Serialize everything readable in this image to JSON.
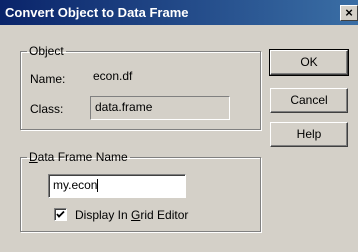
{
  "window": {
    "title": "Convert Object to Data Frame",
    "close_glyph": "✕"
  },
  "object_group": {
    "legend": "Object",
    "name_label": "Name:",
    "name_value": "econ.df",
    "class_label": "Class:",
    "class_value": "data.frame"
  },
  "buttons": {
    "ok": "OK",
    "cancel": "Cancel",
    "help": "Help"
  },
  "dataframe_group": {
    "legend_prefix": "",
    "legend_accel": "D",
    "legend_rest": "ata Frame Name",
    "input_value": "my.econ",
    "checkbox_checked": true,
    "checkbox_label_prefix": "Display In ",
    "checkbox_label_accel": "G",
    "checkbox_label_rest": "rid Editor"
  }
}
